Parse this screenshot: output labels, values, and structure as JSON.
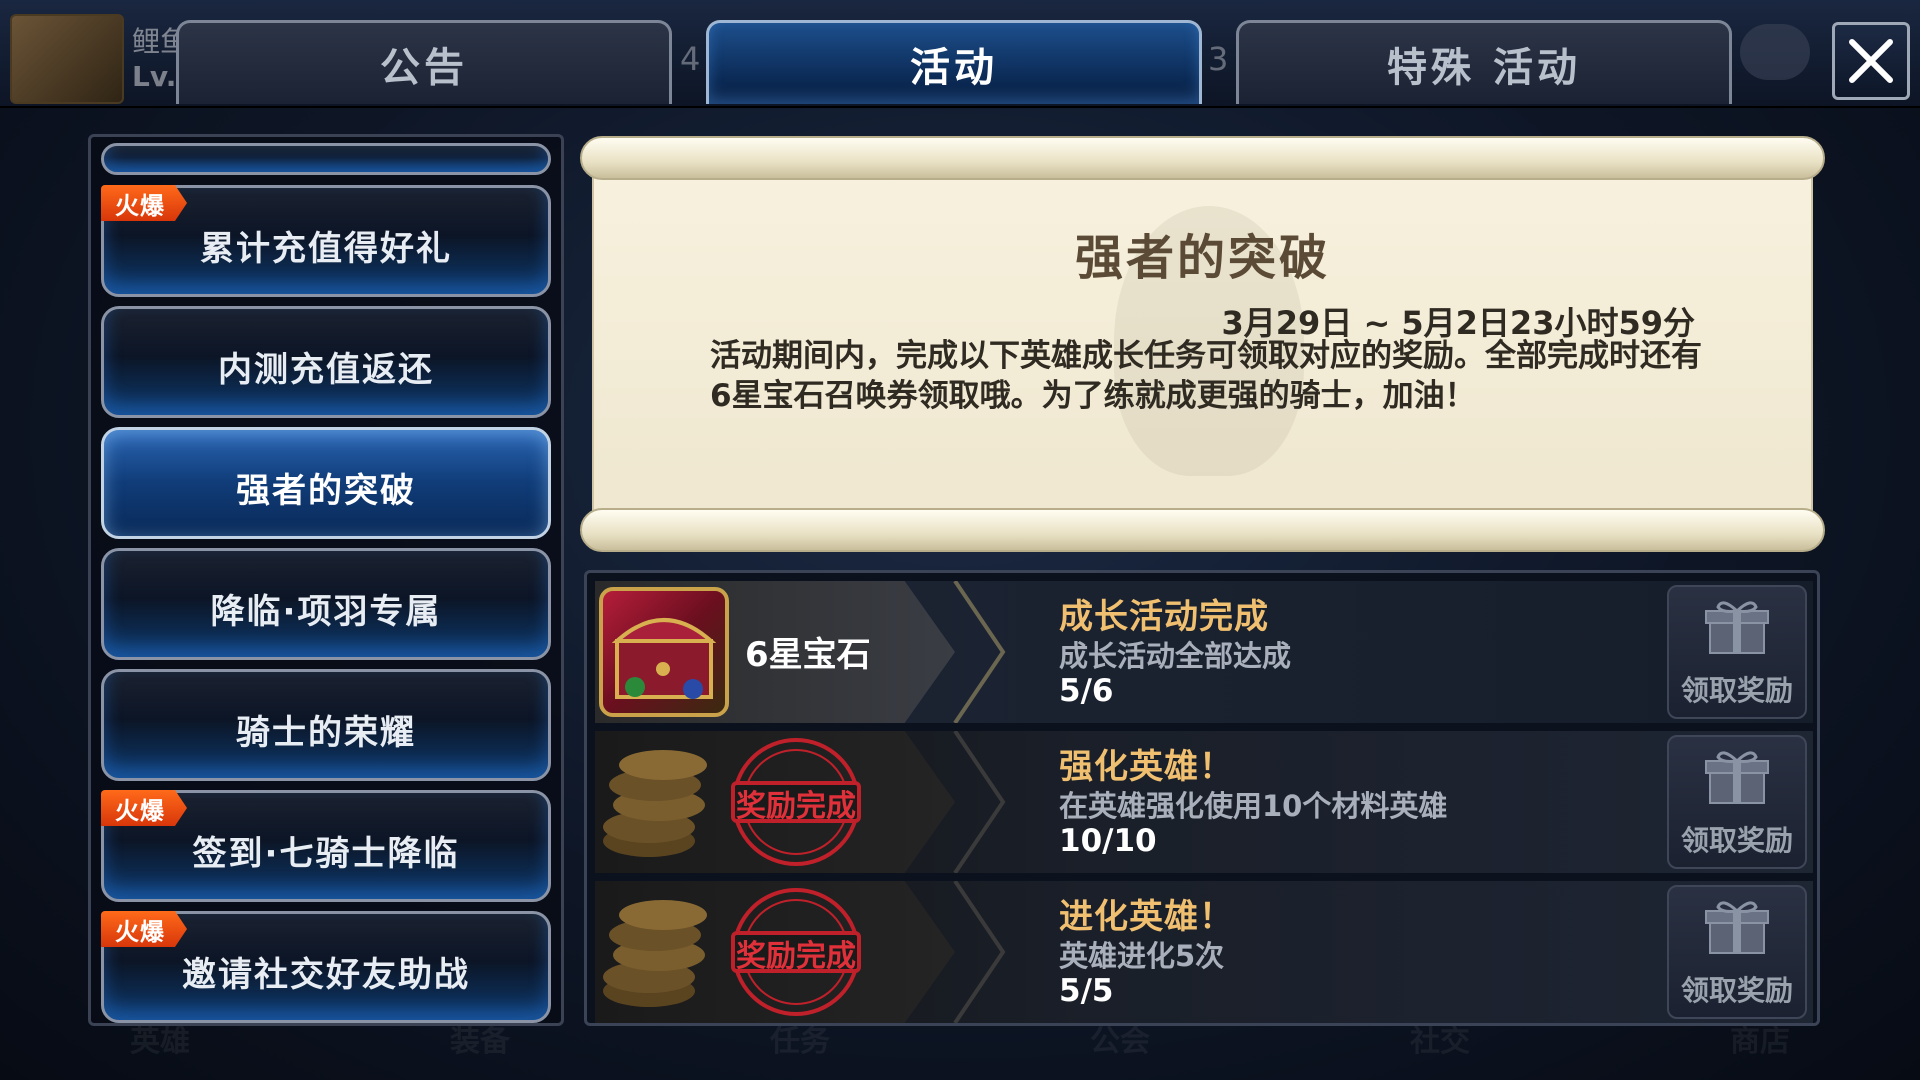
{
  "player": {
    "name": "鲤鱼",
    "level_prefix": "Lv."
  },
  "tabs": [
    {
      "label": "公告",
      "badge": "4"
    },
    {
      "label": "活动",
      "badge": "3"
    },
    {
      "label": "特殊 活动",
      "badge": ""
    }
  ],
  "active_tab": "活动",
  "menu": {
    "items": [
      {
        "label": "",
        "hot": false,
        "selected": false
      },
      {
        "label": "累计充值得好礼",
        "hot": true,
        "hot_label": "火爆",
        "selected": false
      },
      {
        "label": "内测充值返还",
        "hot": false,
        "selected": false
      },
      {
        "label": "强者的突破",
        "hot": false,
        "selected": true
      },
      {
        "label": "降临·项羽专属",
        "hot": false,
        "selected": false
      },
      {
        "label": "骑士的荣耀",
        "hot": false,
        "selected": false
      },
      {
        "label": "签到·七骑士降临",
        "hot": true,
        "hot_label": "火爆",
        "selected": false
      },
      {
        "label": "邀请社交好友助战",
        "hot": true,
        "hot_label": "火爆",
        "selected": false
      }
    ]
  },
  "event": {
    "title": "强者的突破",
    "date_range": "3月29日 ~ 5月2日23小时59分",
    "description": "活动期间内，完成以下英雄成长任务可领取对应的奖励。全部完成时还有6星宝石召唤券领取哦。为了练就成更强的骑士，加油！"
  },
  "tasks": [
    {
      "reward_name": "6星宝石",
      "reward_icon": "treasure-chest-icon",
      "completed": false,
      "title": "成长活动完成",
      "desc": "成长活动全部达成",
      "progress": "5/6",
      "claim_label": "领取奖励"
    },
    {
      "reward_name": "",
      "reward_icon": "gold-coins-icon",
      "completed": true,
      "stamp_label": "奖励完成",
      "title": "强化英雄！",
      "desc": "在英雄强化使用10个材料英雄",
      "progress": "10/10",
      "claim_label": "领取奖励"
    },
    {
      "reward_name": "",
      "reward_icon": "gold-coins-icon",
      "completed": true,
      "stamp_label": "奖励完成",
      "title": "进化英雄！",
      "desc": "英雄进化5次",
      "progress": "5/5",
      "claim_label": "领取奖励"
    }
  ],
  "background_menu": [
    "英雄",
    "装备",
    "任务",
    "公会",
    "社交",
    "商店"
  ],
  "colors": {
    "accent_blue": "#1d4f8c",
    "hot_orange": "#ff6a1a",
    "stamp_red": "#c0202a",
    "task_title": "#f0c070"
  }
}
